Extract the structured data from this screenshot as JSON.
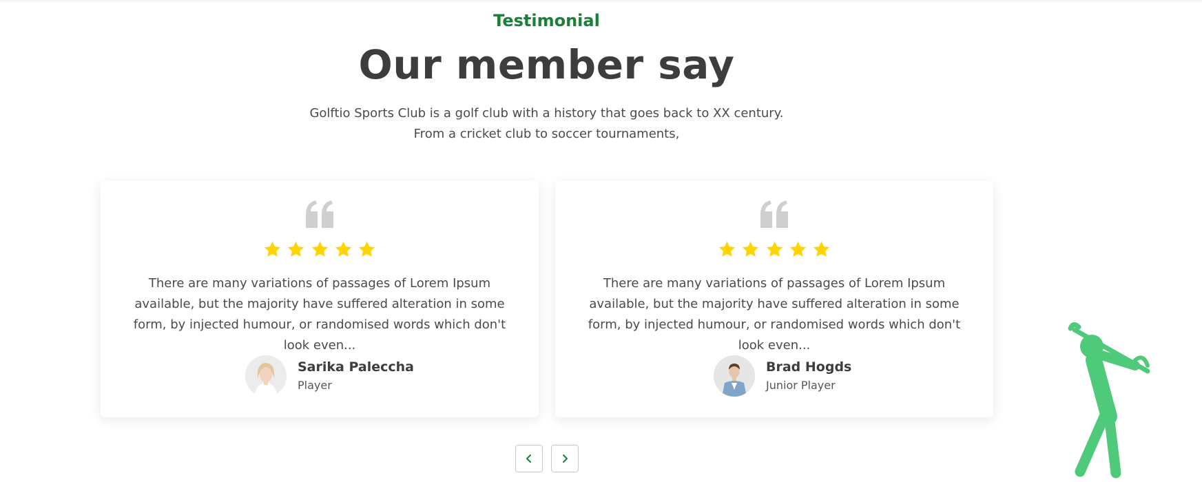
{
  "section": {
    "eyebrow": "Testimonial",
    "title": "Our member say",
    "subtitle": "Golftio Sports Club is a golf club with a history that goes back to XX century. From a cricket club to soccer tournaments,"
  },
  "testimonials": [
    {
      "rating": 5,
      "text": "There are many variations of passages of Lorem Ipsum available, but the majority have suffered alteration in some form, by injected humour, or randomised words which don't look even...",
      "name": "Sarika Paleccha",
      "role": "Player"
    },
    {
      "rating": 5,
      "text": "There are many variations of passages of Lorem Ipsum available, but the majority have suffered alteration in some form, by injected humour, or randomised words which don't look even...",
      "name": "Brad Hogds",
      "role": "Junior Player"
    }
  ],
  "icons": {
    "quote": "quote-icon",
    "star": "star-icon",
    "prev": "chevron-left-icon",
    "next": "chevron-right-icon",
    "decoration": "golfer-icon"
  },
  "colors": {
    "accent": "#1a7f37",
    "star": "#ffd400",
    "quote": "#cfcfcf",
    "golfer": "#4fc97a"
  }
}
